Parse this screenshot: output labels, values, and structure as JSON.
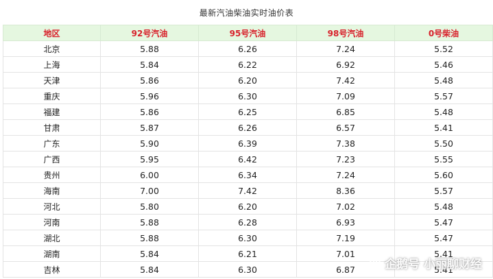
{
  "caption": "最新汽油柴油实时油价表",
  "table": {
    "headers": [
      "地区",
      "92号汽油",
      "95号汽油",
      "98号汽油",
      "0号柴油"
    ],
    "rows": [
      [
        "北京",
        "5.88",
        "6.26",
        "7.24",
        "5.52"
      ],
      [
        "上海",
        "5.84",
        "6.22",
        "6.92",
        "5.46"
      ],
      [
        "天津",
        "5.86",
        "6.20",
        "7.42",
        "5.48"
      ],
      [
        "重庆",
        "5.96",
        "6.30",
        "7.09",
        "5.57"
      ],
      [
        "福建",
        "5.86",
        "6.25",
        "6.85",
        "5.48"
      ],
      [
        "甘肃",
        "5.87",
        "6.26",
        "6.57",
        "5.41"
      ],
      [
        "广东",
        "5.90",
        "6.39",
        "7.38",
        "5.50"
      ],
      [
        "广西",
        "5.95",
        "6.42",
        "7.23",
        "5.55"
      ],
      [
        "贵州",
        "6.00",
        "6.34",
        "7.24",
        "5.60"
      ],
      [
        "海南",
        "7.00",
        "7.42",
        "8.36",
        "5.57"
      ],
      [
        "河北",
        "5.80",
        "6.20",
        "7.02",
        "5.48"
      ],
      [
        "河南",
        "5.88",
        "6.28",
        "6.93",
        "5.47"
      ],
      [
        "湖北",
        "5.88",
        "6.30",
        "7.19",
        "5.47"
      ],
      [
        "湖南",
        "5.84",
        "6.21",
        "7.01",
        "5.41"
      ],
      [
        "吉林",
        "5.84",
        "6.30",
        "6.87",
        "5.41"
      ]
    ]
  },
  "watermark": {
    "text": "企鹅号 小丽聊财经",
    "icon": "penguin-logo-icon"
  },
  "colors": {
    "header_bg": "#e5f7e0",
    "header_text": "#d8202a",
    "border": "#e3e3e3"
  }
}
